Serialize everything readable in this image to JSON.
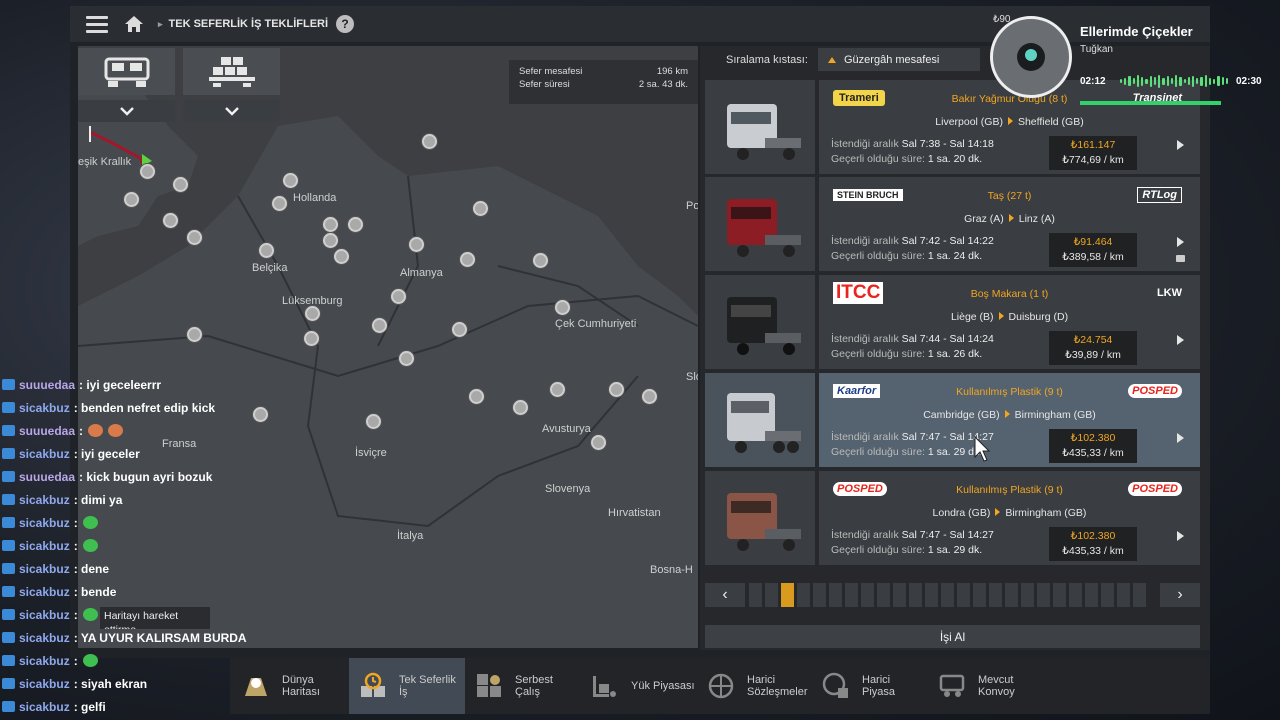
{
  "topbar": {
    "breadcrumb": "TEK SEFERLİK İŞ TEKLİFLERİ",
    "help": "?",
    "money": "₺90..."
  },
  "map": {
    "info": {
      "distance_label": "Sefer mesafesi",
      "distance_value": "196 km",
      "time_label": "Sefer süresi",
      "time_value": "2 sa. 43 dk."
    },
    "labels": [
      "eşik Krallık",
      "Hollanda",
      "Belçika",
      "Almanya",
      "Lüksemburg",
      "Çek Cumhuriyeti",
      "Fransa",
      "İsviçre",
      "Avusturya",
      "Slovenya",
      "Hırvatistan",
      "İtalya",
      "Bosna-H",
      "Po",
      "Slo"
    ]
  },
  "sort": {
    "label": "Sıralama kıstası:",
    "value": "Güzergâh mesafesi"
  },
  "jobs": [
    {
      "company_left": "Trameri",
      "cargo": "Bakır Yağmur Oluğu (8 t)",
      "company_right": "Transinet",
      "from": "Liverpool (GB)",
      "to": "Sheffield (GB)",
      "window_label": "İstendiği aralık",
      "window": "Sal 7:38 - Sal 14:18",
      "validity_label": "Geçerli olduğu süre:",
      "validity": "1 sa. 20 dk.",
      "price": "₺161.147",
      "per_km": "₺774,69 / km"
    },
    {
      "company_left": "STEIN BRUCH",
      "cargo": "Taş (27 t)",
      "company_right": "RTLog",
      "from": "Graz (A)",
      "to": "Linz (A)",
      "window_label": "İstendiği aralık",
      "window": "Sal 7:42 - Sal 14:22",
      "validity_label": "Geçerli olduğu süre:",
      "validity": "1 sa. 24 dk.",
      "price": "₺91.464",
      "per_km": "₺389,58 / km"
    },
    {
      "company_left": "ITCC",
      "cargo": "Boş Makara (1 t)",
      "company_right": "LKW",
      "from": "Liège (B)",
      "to": "Duisburg (D)",
      "window_label": "İstendiği aralık",
      "window": "Sal 7:44 - Sal 14:24",
      "validity_label": "Geçerli olduğu süre:",
      "validity": "1 sa. 26 dk.",
      "price": "₺24.754",
      "per_km": "₺39,89 / km"
    },
    {
      "company_left": "Kaarfor",
      "cargo": "Kullanılmış Plastik (9 t)",
      "company_right": "POSPED",
      "from": "Cambridge (GB)",
      "to": "Birmingham (GB)",
      "window_label": "İstendiği aralık",
      "window": "Sal 7:47 - Sal 14:27",
      "validity_label": "Geçerli olduğu süre:",
      "validity": "1 sa. 29 dk.",
      "price": "₺102.380",
      "per_km": "₺435,33 / km"
    },
    {
      "company_left": "POSPED",
      "cargo": "Kullanılmış Plastik (9 t)",
      "company_right": "POSPED",
      "from": "Londra (GB)",
      "to": "Birmingham (GB)",
      "window_label": "İstendiği aralık",
      "window": "Sal 7:47 - Sal 14:27",
      "validity_label": "Geçerli olduğu süre:",
      "validity": "1 sa. 29 dk.",
      "price": "₺102.380",
      "per_km": "₺435,33 / km"
    }
  ],
  "pager": {
    "prev": "‹",
    "next": "›",
    "active_page": 3,
    "total_pages": 25
  },
  "take_job": "İşi Al",
  "tabs": [
    {
      "line1": "Dünya",
      "line2": "Haritası"
    },
    {
      "line1": "Tek Seferlik",
      "line2": "İş"
    },
    {
      "line1": "Serbest",
      "line2": "Çalış"
    },
    {
      "line1": "Yük Piyasası",
      "line2": ""
    },
    {
      "line1": "Harici",
      "line2": "Sözleşmeler"
    },
    {
      "line1": "Harici",
      "line2": "Piyasa"
    },
    {
      "line1": "Mevcut",
      "line2": "Konvoy"
    }
  ],
  "chat": [
    {
      "user": "suuuedaa",
      "text": ": iyi geceleerrr"
    },
    {
      "user": "sicakbuz",
      "text": ": benden nefret edip kick"
    },
    {
      "user": "suuuedaa",
      "text": ":"
    },
    {
      "user": "sicakbuz",
      "text": ": iyi geceler"
    },
    {
      "user": "suuuedaa",
      "text": ": kick bugun ayri bozuk"
    },
    {
      "user": "sicakbuz",
      "text": ": dimi ya"
    },
    {
      "user": "sicakbuz",
      "text": ":"
    },
    {
      "user": "sicakbuz",
      "text": ":"
    },
    {
      "user": "sicakbuz",
      "text": ": dene"
    },
    {
      "user": "sicakbuz",
      "text": ": bende"
    },
    {
      "user": "sicakbuz",
      "text": ":"
    },
    {
      "user": "sicakbuz",
      "text": ": YA UYUR KALIRSAM BURDA"
    },
    {
      "user": "sicakbuz",
      "text": ":"
    },
    {
      "user": "sicakbuz",
      "text": ": siyah ekran"
    },
    {
      "user": "sicakbuz",
      "text": ": gelfi"
    }
  ],
  "tooltip": "Haritayı hareket ettirme",
  "music": {
    "title": "Ellerimde Çiçekler",
    "artist": "Tuğkan",
    "elapsed": "02:12",
    "total": "02:30",
    "progress": 0.88
  }
}
